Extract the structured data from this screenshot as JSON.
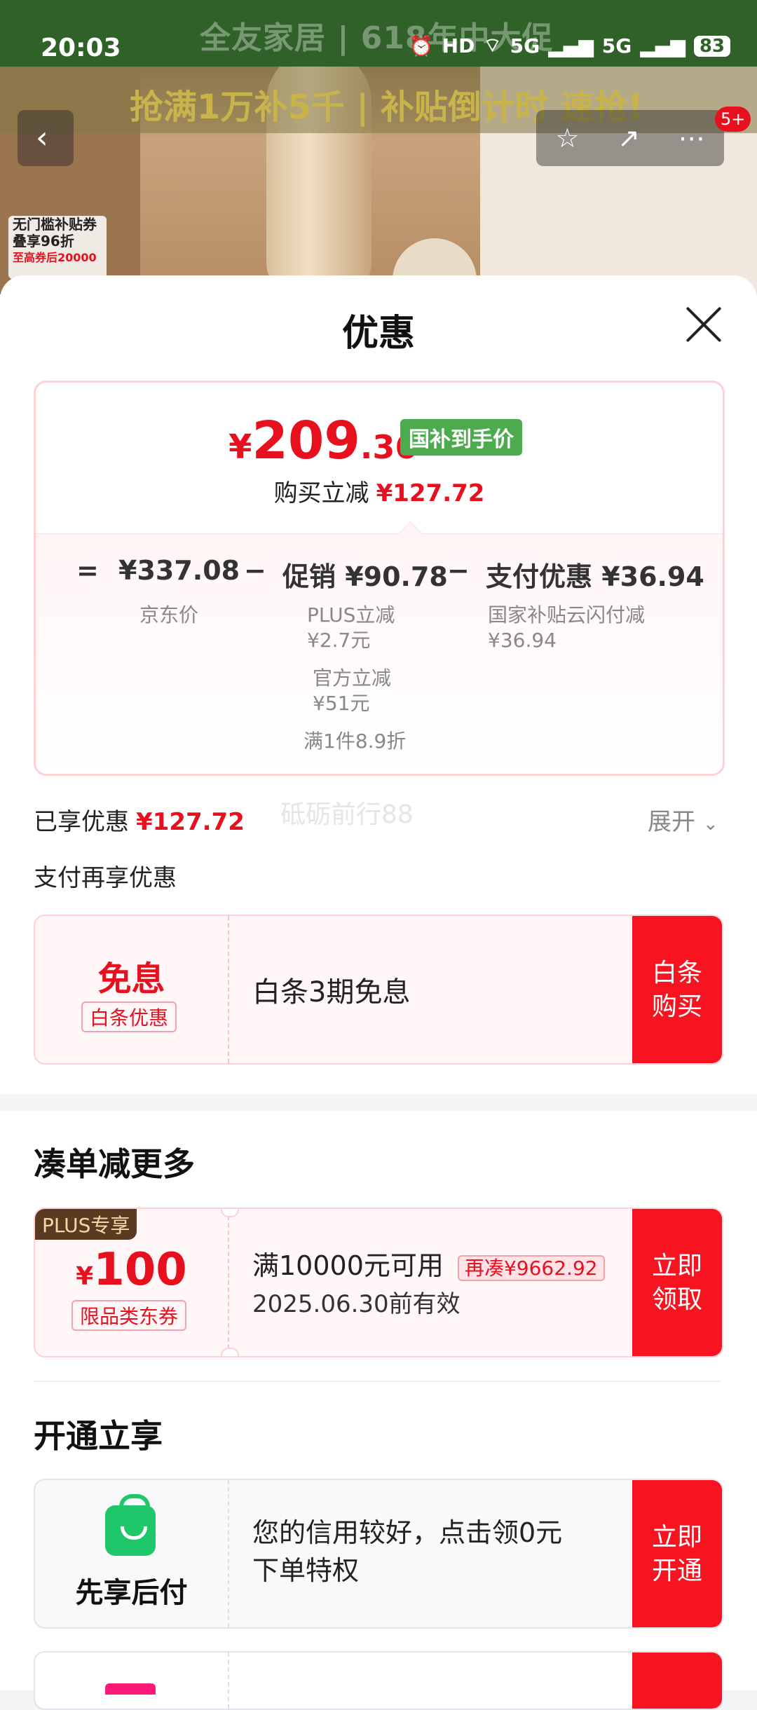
{
  "status_bar": {
    "time": "20:03",
    "hd": "HD",
    "net1": "5G",
    "net2": "5G",
    "battery": "83"
  },
  "background": {
    "banner": "全友家居 | 618年中大促",
    "strip": "抢满1万补5千 | 补贴倒计时 速抢!",
    "coupon_line1": "无门槛补贴券",
    "coupon_line2": "叠享96折",
    "coupon_line3": "至高券后20000",
    "badge": "5+"
  },
  "sheet": {
    "title": "优惠",
    "price": {
      "currency": "¥",
      "integer": "209",
      "decimal": ".36",
      "tag": "国补到手价"
    },
    "reduce": {
      "label": "购买立减",
      "amount": "¥127.72"
    },
    "calc": {
      "eq": "=",
      "jd_price": "¥337.08",
      "jd_label": "京东价",
      "minus1": "−",
      "promo": "促销 ¥90.78",
      "promo_sub1": "PLUS立减",
      "promo_sub1_val": "¥2.7元",
      "promo_sub2": "官方立减",
      "promo_sub2_val": "¥51元",
      "promo_sub3": "满1件8.9折",
      "minus2": "−",
      "pay": "支付优惠 ¥36.94",
      "pay_sub": "国家补贴云闪付减",
      "pay_sub_val": "¥36.94"
    },
    "enjoyed": {
      "label": "已享优惠",
      "amount": "¥127.72"
    },
    "expand": "展开",
    "watermark": "砥砺前行88",
    "pay_more": "支付再享优惠",
    "baitiao": {
      "big": "免息",
      "tag": "白条优惠",
      "desc": "白条3期免息",
      "action_line1": "白条",
      "action_line2": "购买"
    },
    "section_more": "凑单减更多",
    "coupon": {
      "plus_tag": "PLUS专享",
      "currency": "¥",
      "value": "100",
      "tag": "限品类东券",
      "condition": "满10000元可用",
      "gap": "再凑¥9662.92",
      "expiry": "2025.06.30前有效",
      "action_line1": "立即",
      "action_line2": "领取"
    },
    "section_open": "开通立享",
    "credit": {
      "name": "先享后付",
      "desc_line1": "您的信用较好，点击领0元",
      "desc_line2": "下单特权",
      "action_line1": "立即",
      "action_line2": "开通"
    }
  }
}
